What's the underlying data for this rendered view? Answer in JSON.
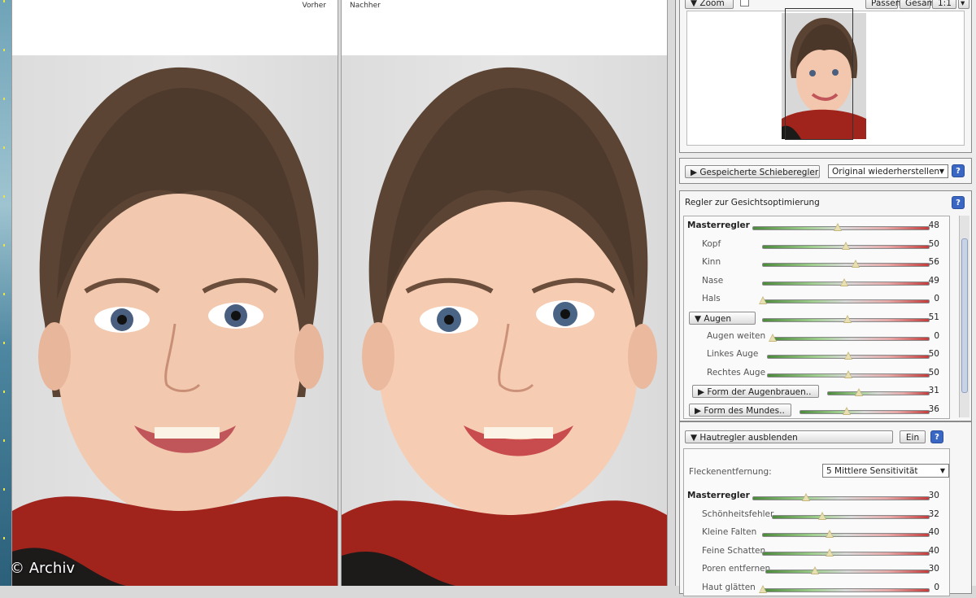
{
  "before_pane": {
    "label": "Vorher"
  },
  "after_pane": {
    "label": "Nachher"
  },
  "watermark": "© Archiv",
  "zoom_panel": {
    "zoom_label": "Zoom",
    "buttons": [
      "Passend",
      "Gesamt",
      "1:1"
    ]
  },
  "saved_sliders": {
    "button_label": "Gespeicherte Schieberegler",
    "select_value": "Original wiederherstellen",
    "help": "?"
  },
  "face_panel": {
    "title": "Regler zur Gesichtsoptimierung",
    "help": "?",
    "sliders": [
      {
        "label": "Masterregler",
        "value": "48",
        "bold": true
      },
      {
        "label": "Kopf",
        "value": "50"
      },
      {
        "label": "Kinn",
        "value": "56"
      },
      {
        "label": "Nase",
        "value": "49"
      },
      {
        "label": "Hals",
        "value": "0"
      },
      {
        "label": "Augen",
        "value": "51",
        "button": true
      },
      {
        "label": "Augen weiten",
        "value": "0"
      },
      {
        "label": "Linkes Auge",
        "value": "50"
      },
      {
        "label": "Rechtes Auge",
        "value": "50"
      },
      {
        "label": "Form der Augenbrauen..",
        "value": "31",
        "button": true
      },
      {
        "label": "Form des Mundes..",
        "value": "36",
        "button": true
      }
    ]
  },
  "skin_panel": {
    "toggle_label": "Hautregler ausblenden",
    "on_button": "Ein",
    "help": "?",
    "blemish_label": "Fleckenentfernung:",
    "blemish_value": "5 Mittlere Sensitivität",
    "sliders": [
      {
        "label": "Masterregler",
        "value": "30",
        "bold": true
      },
      {
        "label": "Schönheitsfehler",
        "value": "32"
      },
      {
        "label": "Kleine Falten",
        "value": "40"
      },
      {
        "label": "Feine Schatten",
        "value": "40"
      },
      {
        "label": "Poren entfernen",
        "value": "30"
      },
      {
        "label": "Haut glätten",
        "value": "0"
      }
    ]
  }
}
